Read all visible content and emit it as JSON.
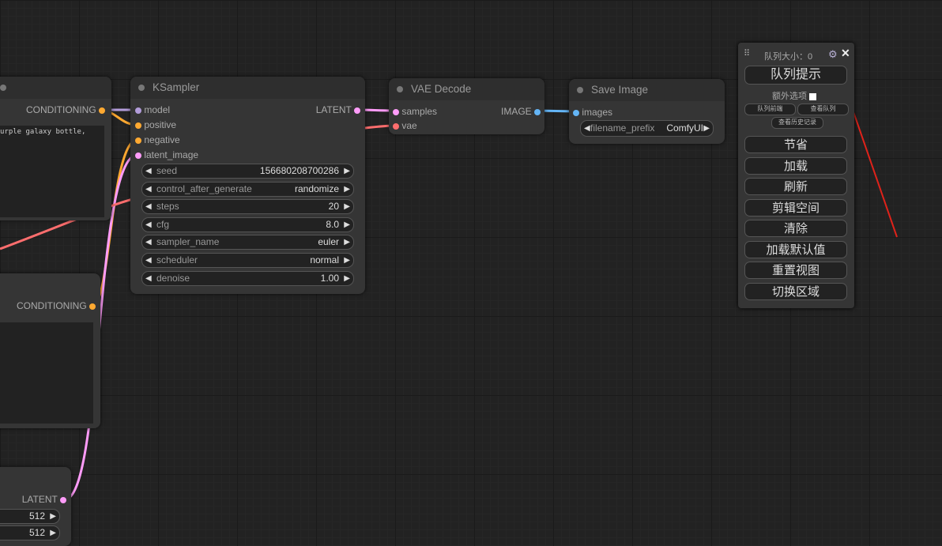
{
  "left_node_top": {
    "output": "CONDITIONING",
    "text": "urple galaxy bottle,"
  },
  "left_node_mid": {
    "output": "CONDITIONING"
  },
  "left_node_bottom": {
    "output": "LATENT",
    "widgets": [
      {
        "value": "512"
      },
      {
        "value": "512"
      }
    ]
  },
  "ksampler": {
    "title": "KSampler",
    "inputs": [
      "model",
      "positive",
      "negative",
      "latent_image"
    ],
    "output": "LATENT",
    "widgets": [
      {
        "label": "seed",
        "value": "156680208700286"
      },
      {
        "label": "control_after_generate",
        "value": "randomize"
      },
      {
        "label": "steps",
        "value": "20"
      },
      {
        "label": "cfg",
        "value": "8.0"
      },
      {
        "label": "sampler_name",
        "value": "euler"
      },
      {
        "label": "scheduler",
        "value": "normal"
      },
      {
        "label": "denoise",
        "value": "1.00"
      }
    ]
  },
  "vae_decode": {
    "title": "VAE Decode",
    "inputs": [
      "samples",
      "vae"
    ],
    "output": "IMAGE"
  },
  "save_image": {
    "title": "Save Image",
    "input": "images",
    "widget": {
      "label": "filename_prefix",
      "value": "ComfyUI"
    }
  },
  "menu": {
    "queue_size": "队列大小：0",
    "queue_prompt": "队列提示",
    "extra_options": "额外选项",
    "small_buttons": [
      "队列前端",
      "查看队列",
      "查看历史记录"
    ],
    "buttons": [
      "节省",
      "加载",
      "刷新",
      "剪辑空间",
      "清除",
      "加载默认值",
      "重置视图",
      "切换区域"
    ]
  },
  "colors": {
    "conditioning": "#ffa931",
    "latent": "#ff9cf9",
    "model": "#b39ddb",
    "vae": "#ff6e6e",
    "image": "#64b5f6"
  }
}
